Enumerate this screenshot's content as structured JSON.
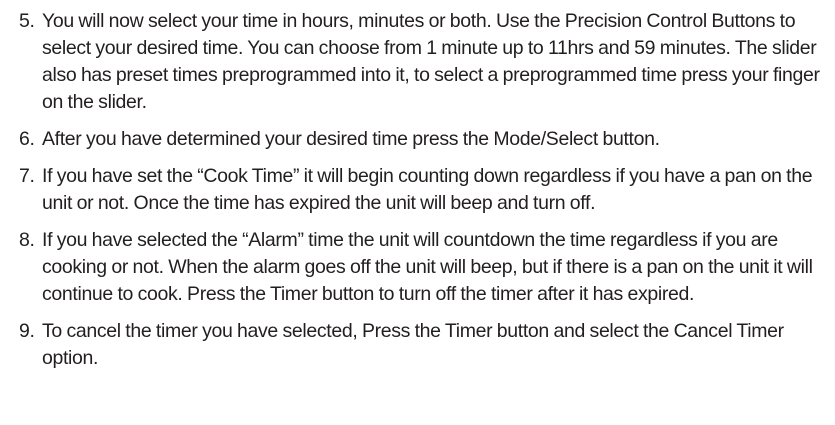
{
  "instructions": {
    "steps": [
      {
        "number": "5.",
        "text": "You will now select your time in hours, minutes or both. Use the Precision Control Buttons to select your desired time. You can choose from 1 minute up to 11hrs and 59 minutes. The slider also has preset times preprogrammed into it, to select a preprogrammed time press your finger on the slider."
      },
      {
        "number": "6.",
        "text": "After you have determined your desired time press the Mode/Select button."
      },
      {
        "number": "7.",
        "text": "If you have set the “Cook Time” it will begin counting down regardless if you have a pan on the unit or not. Once the time has expired the unit will beep and turn off."
      },
      {
        "number": "8.",
        "text": "If you have selected the “Alarm” time the unit will countdown the time regardless if you are cooking or not. When the alarm goes off the unit will beep, but if there is a pan on the unit it will continue to cook. Press the Timer button to turn off the timer after it has expired."
      },
      {
        "number": "9.",
        "text": "To cancel the timer you have selected, Press the Timer button and select the Cancel Timer option."
      }
    ]
  }
}
